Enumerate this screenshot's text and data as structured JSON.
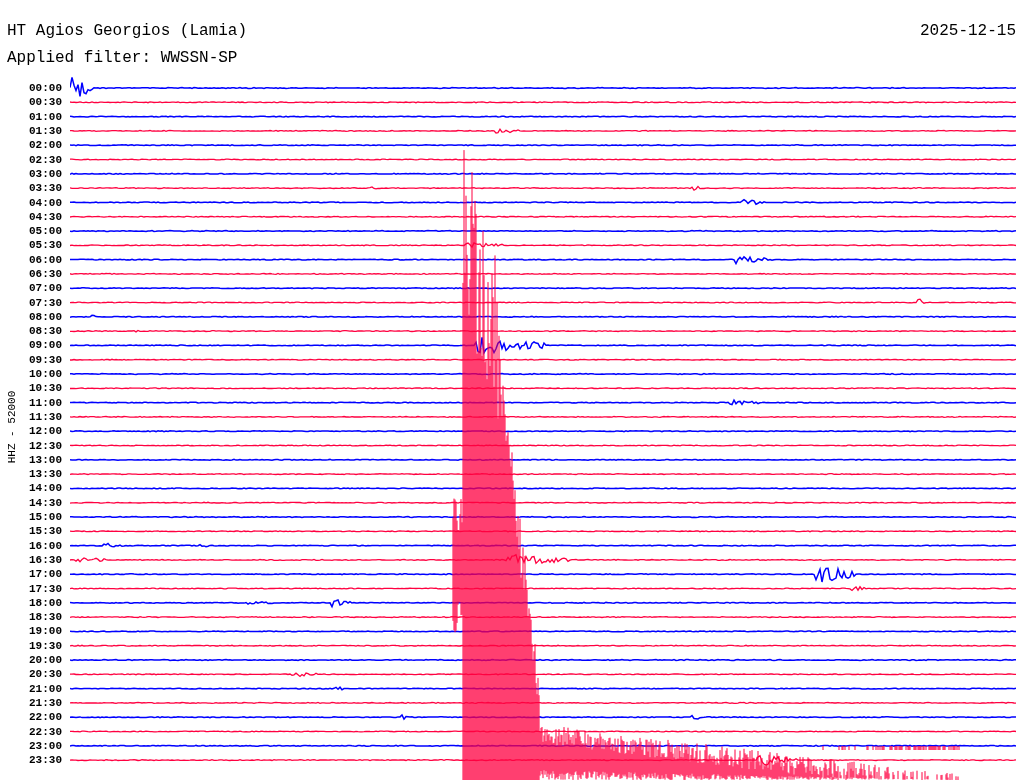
{
  "station": "HT Agios Georgios (Lamia)",
  "date": "2025-12-15",
  "filter": "Applied filter: WWSSN-SP",
  "axis_label": "HHZ - 52000",
  "traces": [
    {
      "time": "00:00",
      "color": "#0000ff"
    },
    {
      "time": "00:30",
      "color": "#ff0040"
    },
    {
      "time": "01:00",
      "color": "#0000ff"
    },
    {
      "time": "01:30",
      "color": "#ff0040"
    },
    {
      "time": "02:00",
      "color": "#0000ff"
    },
    {
      "time": "02:30",
      "color": "#ff0040"
    },
    {
      "time": "03:00",
      "color": "#0000ff"
    },
    {
      "time": "03:30",
      "color": "#ff0040"
    },
    {
      "time": "04:00",
      "color": "#0000ff"
    },
    {
      "time": "04:30",
      "color": "#ff0040"
    },
    {
      "time": "05:00",
      "color": "#0000ff"
    },
    {
      "time": "05:30",
      "color": "#ff0040"
    },
    {
      "time": "06:00",
      "color": "#0000ff"
    },
    {
      "time": "06:30",
      "color": "#ff0040"
    },
    {
      "time": "07:00",
      "color": "#0000ff"
    },
    {
      "time": "07:30",
      "color": "#ff0040"
    },
    {
      "time": "08:00",
      "color": "#0000ff"
    },
    {
      "time": "08:30",
      "color": "#ff0040"
    },
    {
      "time": "09:00",
      "color": "#0000ff"
    },
    {
      "time": "09:30",
      "color": "#ff0040"
    },
    {
      "time": "10:00",
      "color": "#0000ff"
    },
    {
      "time": "10:30",
      "color": "#ff0040"
    },
    {
      "time": "11:00",
      "color": "#0000ff"
    },
    {
      "time": "11:30",
      "color": "#ff0040"
    },
    {
      "time": "12:00",
      "color": "#0000ff"
    },
    {
      "time": "12:30",
      "color": "#ff0040"
    },
    {
      "time": "13:00",
      "color": "#0000ff"
    },
    {
      "time": "13:30",
      "color": "#ff0040"
    },
    {
      "time": "14:00",
      "color": "#0000ff"
    },
    {
      "time": "14:30",
      "color": "#ff0040"
    },
    {
      "time": "15:00",
      "color": "#0000ff"
    },
    {
      "time": "15:30",
      "color": "#ff0040"
    },
    {
      "time": "16:00",
      "color": "#0000ff"
    },
    {
      "time": "16:30",
      "color": "#ff0040"
    },
    {
      "time": "17:00",
      "color": "#0000ff"
    },
    {
      "time": "17:30",
      "color": "#ff0040"
    },
    {
      "time": "18:00",
      "color": "#0000ff"
    },
    {
      "time": "18:30",
      "color": "#ff0040"
    },
    {
      "time": "19:00",
      "color": "#0000ff"
    },
    {
      "time": "19:30",
      "color": "#ff0040"
    },
    {
      "time": "20:00",
      "color": "#0000ff"
    },
    {
      "time": "20:30",
      "color": "#ff0040"
    },
    {
      "time": "21:00",
      "color": "#0000ff"
    },
    {
      "time": "21:30",
      "color": "#ff0040"
    },
    {
      "time": "22:00",
      "color": "#0000ff"
    },
    {
      "time": "22:30",
      "color": "#ff0040"
    },
    {
      "time": "23:00",
      "color": "#0000ff"
    },
    {
      "time": "23:30",
      "color": "#ff0040"
    }
  ]
}
